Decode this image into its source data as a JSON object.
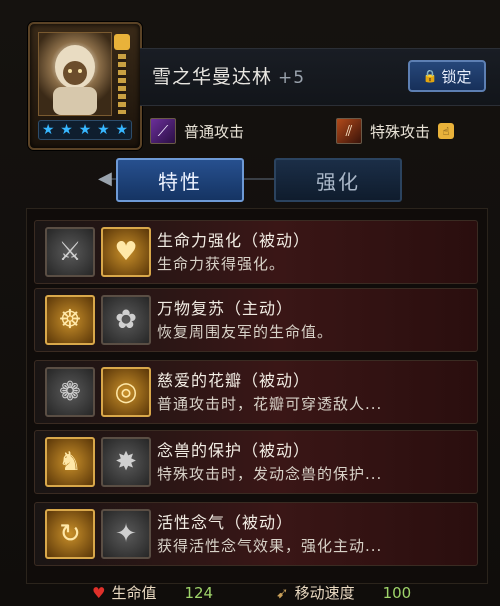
{
  "hero": {
    "name": "雪之华曼达林",
    "enhance": "+5",
    "stars": [
      "★",
      "★",
      "★",
      "★",
      "★"
    ]
  },
  "header": {
    "lock_label": "锁定"
  },
  "attacks": {
    "normal": "普通攻击",
    "special": "特殊攻击"
  },
  "tabs": [
    {
      "label": "特性",
      "active": true
    },
    {
      "label": "强化",
      "active": false
    }
  ],
  "skills": [
    {
      "name": "生命力强化（被动）",
      "desc": "生命力获得强化。",
      "icons": [
        "sword-icon",
        "heart-figure-icon"
      ]
    },
    {
      "name": "万物复苏（主动）",
      "desc": "恢复周围友军的生命值。",
      "icons": [
        "meditate-icon",
        "flower-icon"
      ]
    },
    {
      "name": "慈爱的花瓣（被动）",
      "desc": "普通攻击时，花瓣可穿透敌人...",
      "icons": [
        "petal-icon",
        "dragon-orb-icon"
      ]
    },
    {
      "name": "念兽的保护（被动）",
      "desc": "特殊攻击时，发动念兽的保护...",
      "icons": [
        "beast-icon",
        "claw-icon"
      ]
    },
    {
      "name": "活性念气（被动）",
      "desc": "获得活性念气效果，强化主动...",
      "icons": [
        "spin-icon",
        "aura-figure-icon"
      ]
    }
  ],
  "stats": {
    "hp_label": "生命值",
    "hp_value": "124",
    "speed_label": "移动速度",
    "speed_value": "100"
  },
  "colors": {
    "star": "#37b7ff",
    "tab_active": "#27508f",
    "stat_value": "#9fd46a",
    "row_red": "#3a1616"
  }
}
